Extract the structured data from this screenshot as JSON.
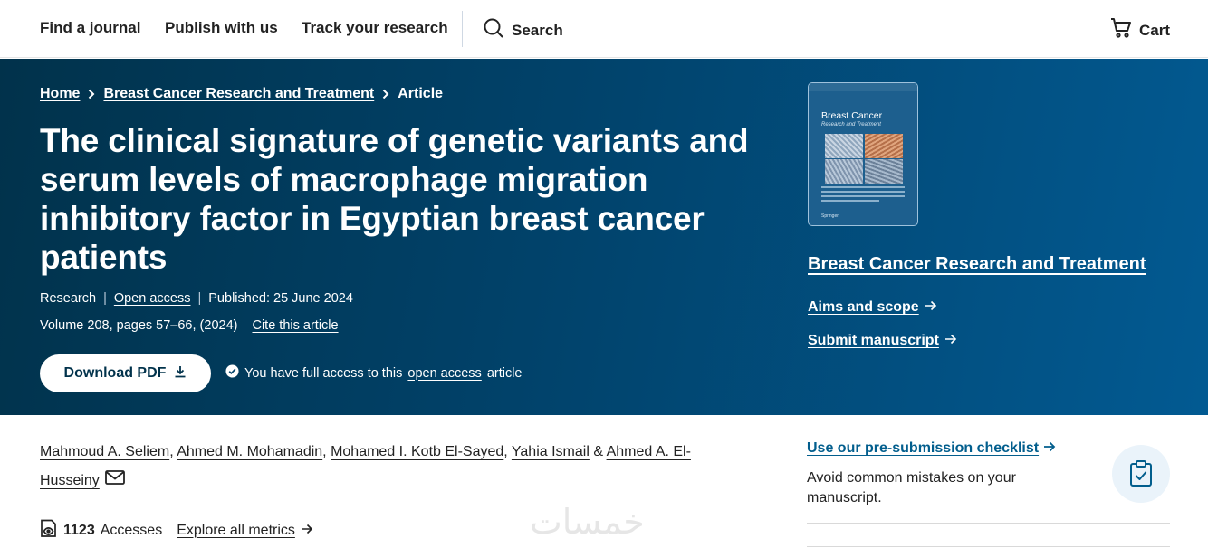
{
  "nav": {
    "find_journal": "Find a journal",
    "publish": "Publish with us",
    "track": "Track your research",
    "search": "Search",
    "cart": "Cart"
  },
  "breadcrumb": {
    "home": "Home",
    "journal": "Breast Cancer Research and Treatment",
    "current": "Article"
  },
  "article": {
    "title": "The clinical signature of genetic variants and serum levels of macrophage migration inhibitory factor in Egyptian breast cancer patients",
    "type": "Research",
    "open_access": "Open access",
    "published": "Published: 25 June 2024",
    "volume": "Volume 208, pages 57–66, (2024)",
    "cite": "Cite this article",
    "download": "Download PDF",
    "access_prefix": "You have full access to this",
    "access_link": "open access",
    "access_suffix": "article"
  },
  "journal": {
    "cover_title": "Breast Cancer",
    "cover_subtitle": "Research and Treatment",
    "cover_publisher": "Springer",
    "name": "Breast Cancer Research and Treatment",
    "aims": "Aims and scope",
    "submit": "Submit manuscript"
  },
  "authors": {
    "a1": "Mahmoud A. Seliem",
    "a2": "Ahmed M. Mohamadin",
    "a3": "Mohamed I. Kotb El-Sayed",
    "a4": "Yahia Ismail",
    "a5": "Ahmed A. El-Husseiny",
    "comma": ",",
    "amp": "&"
  },
  "metrics": {
    "accesses_count": "1123",
    "accesses_label": "Accesses",
    "explore": "Explore all metrics"
  },
  "checklist": {
    "link": "Use our pre-submission checklist",
    "desc": "Avoid common mistakes on your manuscript."
  },
  "watermark": "خمسات",
  "colors": {
    "hero_dark": "#01324b",
    "hero_light": "#025a92",
    "link_blue": "#025e8d"
  }
}
